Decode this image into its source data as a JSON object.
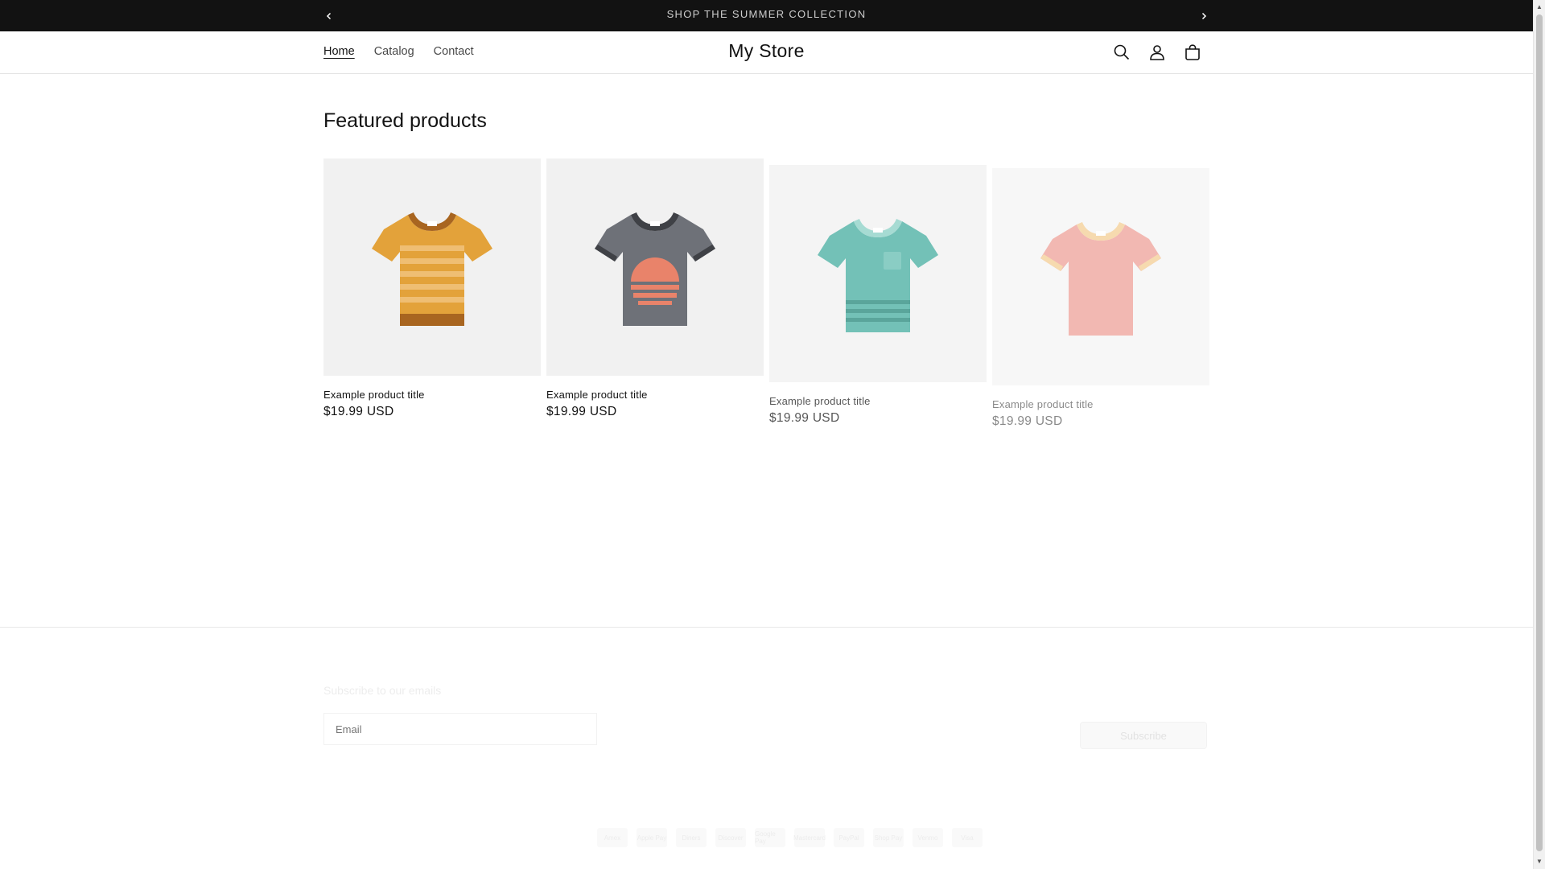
{
  "announcement": {
    "text": "SHOP THE SUMMER COLLECTION",
    "prev_icon": "chevron-left-icon",
    "next_icon": "chevron-right-icon"
  },
  "header": {
    "nav": [
      {
        "label": "Home",
        "active": true
      },
      {
        "label": "Catalog"
      },
      {
        "label": "Contact"
      }
    ],
    "brand": "My Store",
    "icons": [
      "search-icon",
      "account-icon",
      "cart-icon"
    ]
  },
  "featured": {
    "title": "Featured products",
    "products": [
      {
        "title": "Example product title",
        "price": "$19.99 USD",
        "color": "#e3a23a"
      },
      {
        "title": "Example product title",
        "price": "$19.99 USD",
        "color": "#6e7178"
      },
      {
        "title": "Example product title",
        "price": "$19.99 USD",
        "color": "#73c1b7"
      },
      {
        "title": "Example product title",
        "price": "$19.99 USD",
        "color": "#f2b2ab"
      }
    ]
  },
  "footer": {
    "subscribe_heading": "Subscribe to our emails",
    "email_placeholder": "Email",
    "subscribe_button": "Subscribe",
    "payment_methods": [
      "Amex",
      "Apple Pay",
      "Diners",
      "Discover",
      "Google Pay",
      "Mastercard",
      "PayPal",
      "Shop Pay",
      "Venmo",
      "Visa"
    ]
  },
  "colors": {
    "accent": "#121212",
    "background": "#ffffff",
    "product_bg": "#f1f1f1"
  }
}
